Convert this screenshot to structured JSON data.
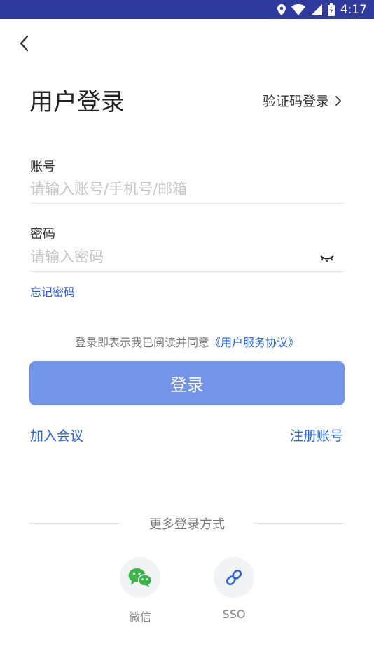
{
  "status_bar": {
    "time": "4:17"
  },
  "header": {
    "title": "用户登录",
    "alt_login_label": "验证码登录"
  },
  "account": {
    "label": "账号",
    "placeholder": "请输入账号/手机号/邮箱",
    "value": ""
  },
  "password": {
    "label": "密码",
    "placeholder": "请输入密码",
    "value": ""
  },
  "forgot_label": "忘记密码",
  "agreement": {
    "prefix": "登录即表示我已阅读并同意",
    "link": "《用户服务协议》"
  },
  "login_button_label": "登录",
  "links": {
    "join_meeting": "加入会议",
    "register": "注册账号"
  },
  "more_login": {
    "title": "更多登录方式",
    "options": [
      {
        "label": "微信",
        "icon": "wechat-icon"
      },
      {
        "label": "SSO",
        "icon": "link-icon"
      }
    ]
  },
  "colors": {
    "status_bar": "#2f3a9c",
    "accent": "#2a63d6",
    "button": "#7494e8"
  }
}
